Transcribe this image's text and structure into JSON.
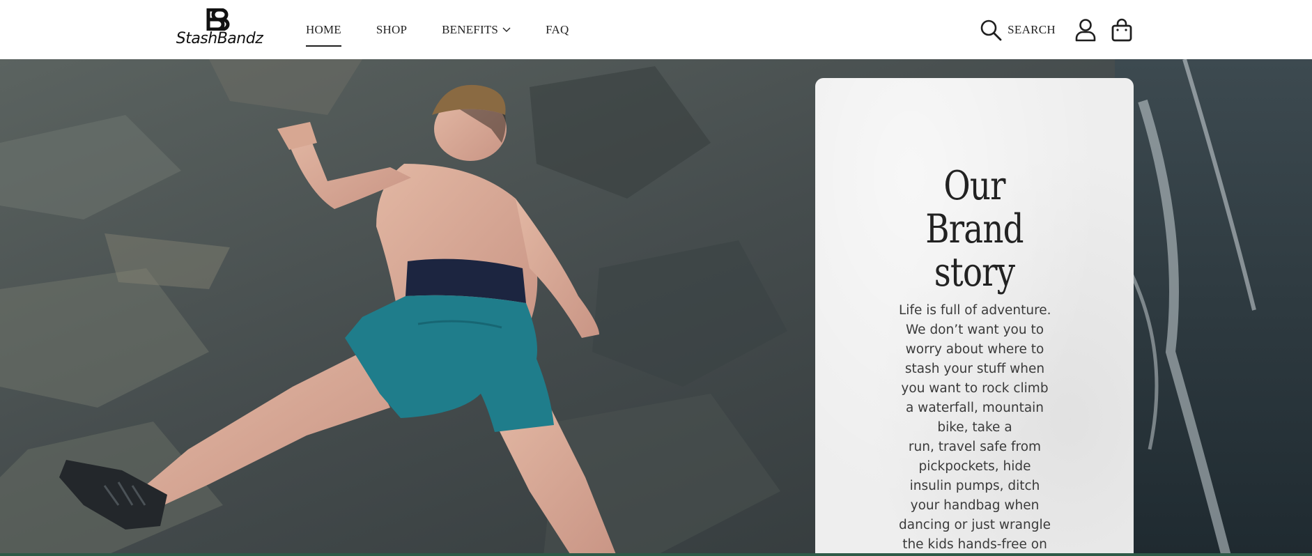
{
  "brand": {
    "logo_text": "StashBandz"
  },
  "nav": {
    "items": [
      {
        "label": "HOME",
        "active": true
      },
      {
        "label": "SHOP",
        "active": false
      },
      {
        "label": "BENEFITS",
        "active": false,
        "dropdown": true
      },
      {
        "label": "FAQ",
        "active": false
      }
    ]
  },
  "tools": {
    "search_label": "SEARCH",
    "icons": [
      "search-icon",
      "account-icon",
      "cart-icon"
    ]
  },
  "hero": {
    "title_lines": [
      "Our",
      "Brand",
      "story"
    ],
    "body_lines": [
      "Life is full of adventure.",
      "We don’t want you to",
      "worry about where to",
      "stash your stuff when",
      "you want to rock climb",
      "a waterfall, mountain",
      "bike, take a",
      "run, travel safe from",
      "pickpockets, hide",
      "insulin pumps, ditch",
      "your handbag when",
      "dancing or just wrangle",
      "the kids hands-free on"
    ]
  },
  "colors": {
    "accent_bottom": "#2e5a47",
    "card_bg": "#eeeeee",
    "shorts": "#1f7d8b"
  }
}
